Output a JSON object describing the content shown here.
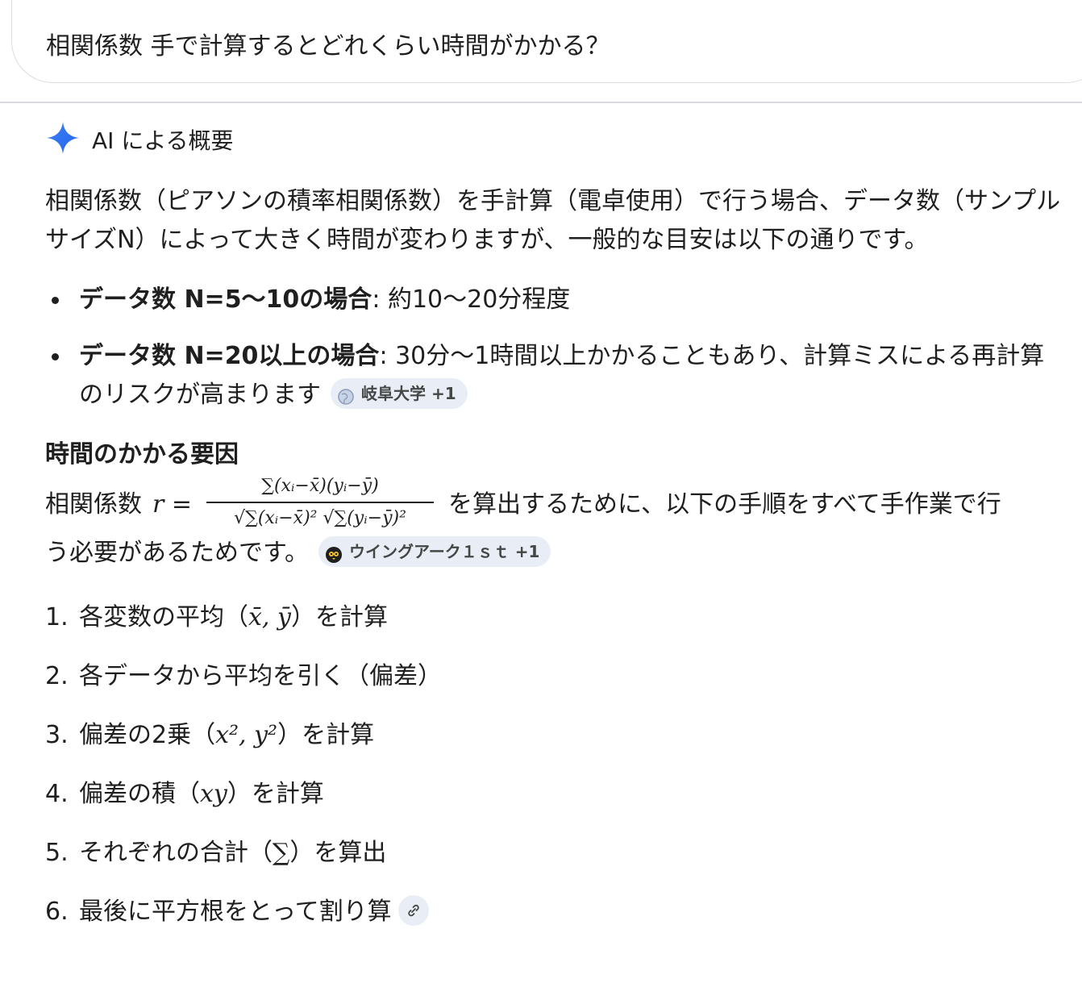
{
  "search": {
    "query": "相関係数 手で計算するとどれくらい時間がかかる？"
  },
  "ai_overview": {
    "title": "AI による概要",
    "intro": "相関係数（ピアソンの積率相関係数）を手計算（電卓使用）で行う場合、データ数（サンプルサイズN）によって大きく時間が変わりますが、一般的な目安は以下の通りです。",
    "bullets": [
      {
        "bold": "データ数 N=5〜10の場合",
        "text": ": 約10〜20分程度"
      },
      {
        "bold": "データ数 N=20以上の場合",
        "text": ": 30分〜1時間以上かかることもあり、計算ミスによる再計算のリスクが高まります",
        "chip": "岐阜大学 +1"
      }
    ],
    "section_title": "時間のかかる要因",
    "formula_pre": "相関係数",
    "formula_r": "r =",
    "formula_numerator": "∑(xᵢ−x̄)(yᵢ−ȳ)",
    "formula_denominator": "√∑(xᵢ−x̄)² √∑(yᵢ−ȳ)²",
    "formula_post": "を算出するために、以下の手順をすべて手作業で行",
    "formula_post2": "う必要があるためです。",
    "formula_chip": "ウイングアーク１ｓｔ +1",
    "steps": [
      {
        "num": "1.",
        "pre": "各変数の平均（",
        "math": "x̄, ȳ",
        "post": "）を計算"
      },
      {
        "num": "2.",
        "pre": "各データから平均を引く（偏差）",
        "math": "",
        "post": ""
      },
      {
        "num": "3.",
        "pre": "偏差の2乗（",
        "math": "x², y²",
        "post": "）を計算"
      },
      {
        "num": "4.",
        "pre": "偏差の積（",
        "math": "xy",
        "post": "）を計算"
      },
      {
        "num": "5.",
        "pre": "それぞれの合計（",
        "math": "∑",
        "post": "）を算出"
      },
      {
        "num": "6.",
        "pre": "最後に平方根をとって割り算",
        "math": "",
        "post": ""
      }
    ]
  },
  "colors": {
    "accent": "#4285f4",
    "chip_bg": "#e9edf5"
  }
}
